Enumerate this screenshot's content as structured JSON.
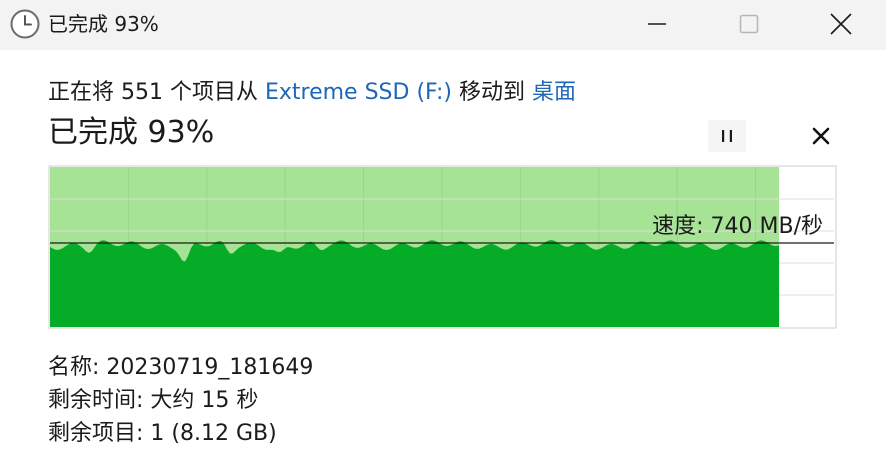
{
  "window": {
    "title": "已完成 93%",
    "icon": "clock-icon",
    "controls": [
      "minimize-icon",
      "maximize-icon",
      "close-icon"
    ]
  },
  "operation": {
    "prefix": "正在将 551 个项目从 ",
    "source": "Extreme SSD (F:)",
    "middle": " 移动到 ",
    "destination": "桌面"
  },
  "progress": {
    "label": "已完成 93%",
    "percent": 93,
    "speed_label": "速度: 740 MB/秒",
    "speed_mbps": 740,
    "pause_icon": "pause-icon",
    "cancel_icon": "cancel-icon"
  },
  "details": {
    "name_label": "名称:",
    "name_value": "20230719_181649",
    "time_label": "剩余时间:",
    "time_value": "大约 15 秒",
    "items_label": "剩余项目:",
    "items_value": "1 (8.12 GB)"
  },
  "colors": {
    "titlebar": "#f3f3f3",
    "link": "#1e66b8",
    "progress_fill": "#a6e394",
    "speed_fill": "#06ab27",
    "grid": "#dcdcdc"
  }
}
